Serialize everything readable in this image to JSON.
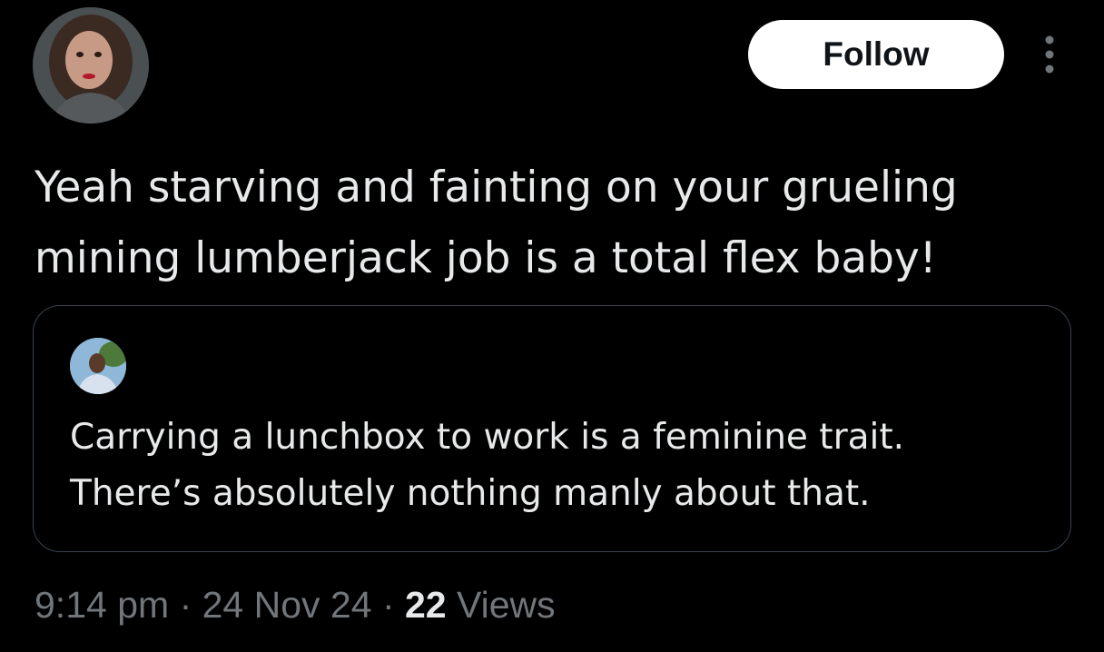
{
  "header": {
    "follow_label": "Follow",
    "more_icon": "more-vertical-icon"
  },
  "tweet": {
    "text_line1": "Yeah starving and fainting on your grueling",
    "text_line2": "mining lumberjack job is a total flex baby!"
  },
  "quote": {
    "text_line1": "Carrying a lunchbox to work is a feminine trait.",
    "text_line2": "There’s absolutely nothing manly about that."
  },
  "meta": {
    "time": "9:14 pm",
    "separator": "·",
    "date": "24 Nov 24",
    "views_count": "22",
    "views_label": "Views"
  },
  "colors": {
    "background": "#000000",
    "text_primary": "#e7e9ea",
    "text_secondary": "#71767b",
    "border": "#38444d",
    "follow_bg": "#ffffff"
  }
}
